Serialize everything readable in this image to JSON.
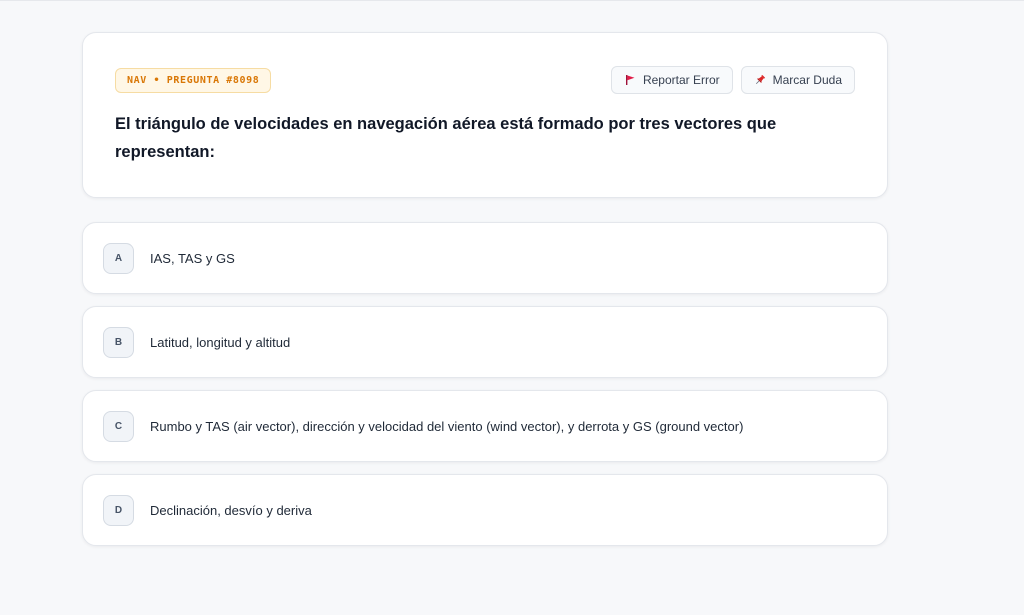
{
  "question": {
    "tag": "NAV • PREGUNTA #8098",
    "text": "El triángulo de velocidades en navegación aérea está formado por tres vectores que representan:",
    "actions": {
      "report_label": "Reportar Error",
      "report_icon": "flag-icon",
      "mark_label": "Marcar Duda",
      "mark_icon": "pin-icon"
    }
  },
  "options": [
    {
      "letter": "A",
      "text": "IAS, TAS y GS"
    },
    {
      "letter": "B",
      "text": "Latitud, longitud y altitud"
    },
    {
      "letter": "C",
      "text": "Rumbo y TAS (air vector), dirección y velocidad del viento (wind vector), y derrota y GS (ground vector)"
    },
    {
      "letter": "D",
      "text": "Declinación, desvío y deriva"
    }
  ],
  "colors": {
    "tag_text": "#d97706",
    "tag_bg": "#fff7e6",
    "flag": "#e11d48",
    "pin": "#dc2626"
  }
}
